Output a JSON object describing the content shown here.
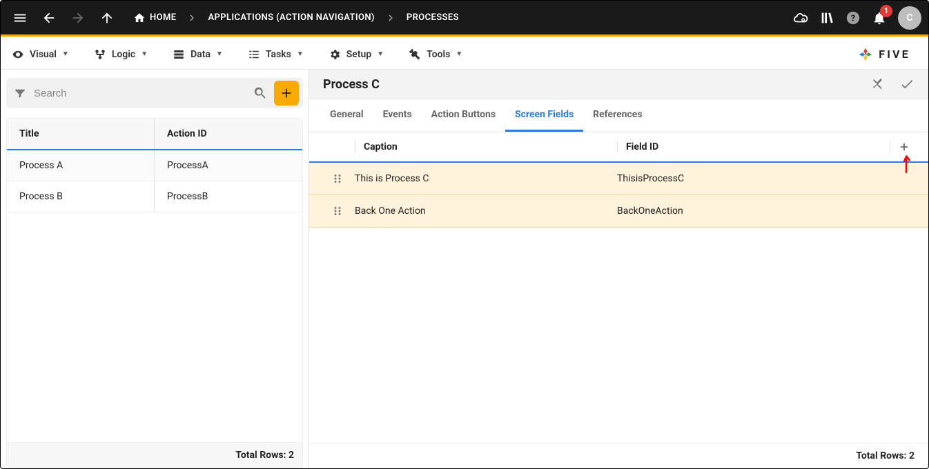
{
  "breadcrumbs": {
    "home": "HOME",
    "apps": "APPLICATIONS (ACTION NAVIGATION)",
    "processes": "PROCESSES"
  },
  "topbar": {
    "notification_count": "1",
    "avatar_initial": "C"
  },
  "menu": {
    "visual": "Visual",
    "logic": "Logic",
    "data": "Data",
    "tasks": "Tasks",
    "setup": "Setup",
    "tools": "Tools"
  },
  "brand": "FIVE",
  "search": {
    "placeholder": "Search"
  },
  "left_table": {
    "col_title": "Title",
    "col_action": "Action ID",
    "rows": [
      {
        "title": "Process A",
        "action_id": "ProcessA"
      },
      {
        "title": "Process B",
        "action_id": "ProcessB"
      }
    ],
    "footer": "Total Rows: 2"
  },
  "detail": {
    "title": "Process C"
  },
  "tabs": {
    "general": "General",
    "events": "Events",
    "action_buttons": "Action Buttons",
    "screen_fields": "Screen Fields",
    "references": "References"
  },
  "fields_table": {
    "col_caption": "Caption",
    "col_fieldid": "Field ID",
    "rows": [
      {
        "caption": "This is Process C",
        "field_id": "ThisisProcessC"
      },
      {
        "caption": "Back One Action",
        "field_id": "BackOneAction"
      }
    ],
    "footer": "Total Rows: 2"
  }
}
